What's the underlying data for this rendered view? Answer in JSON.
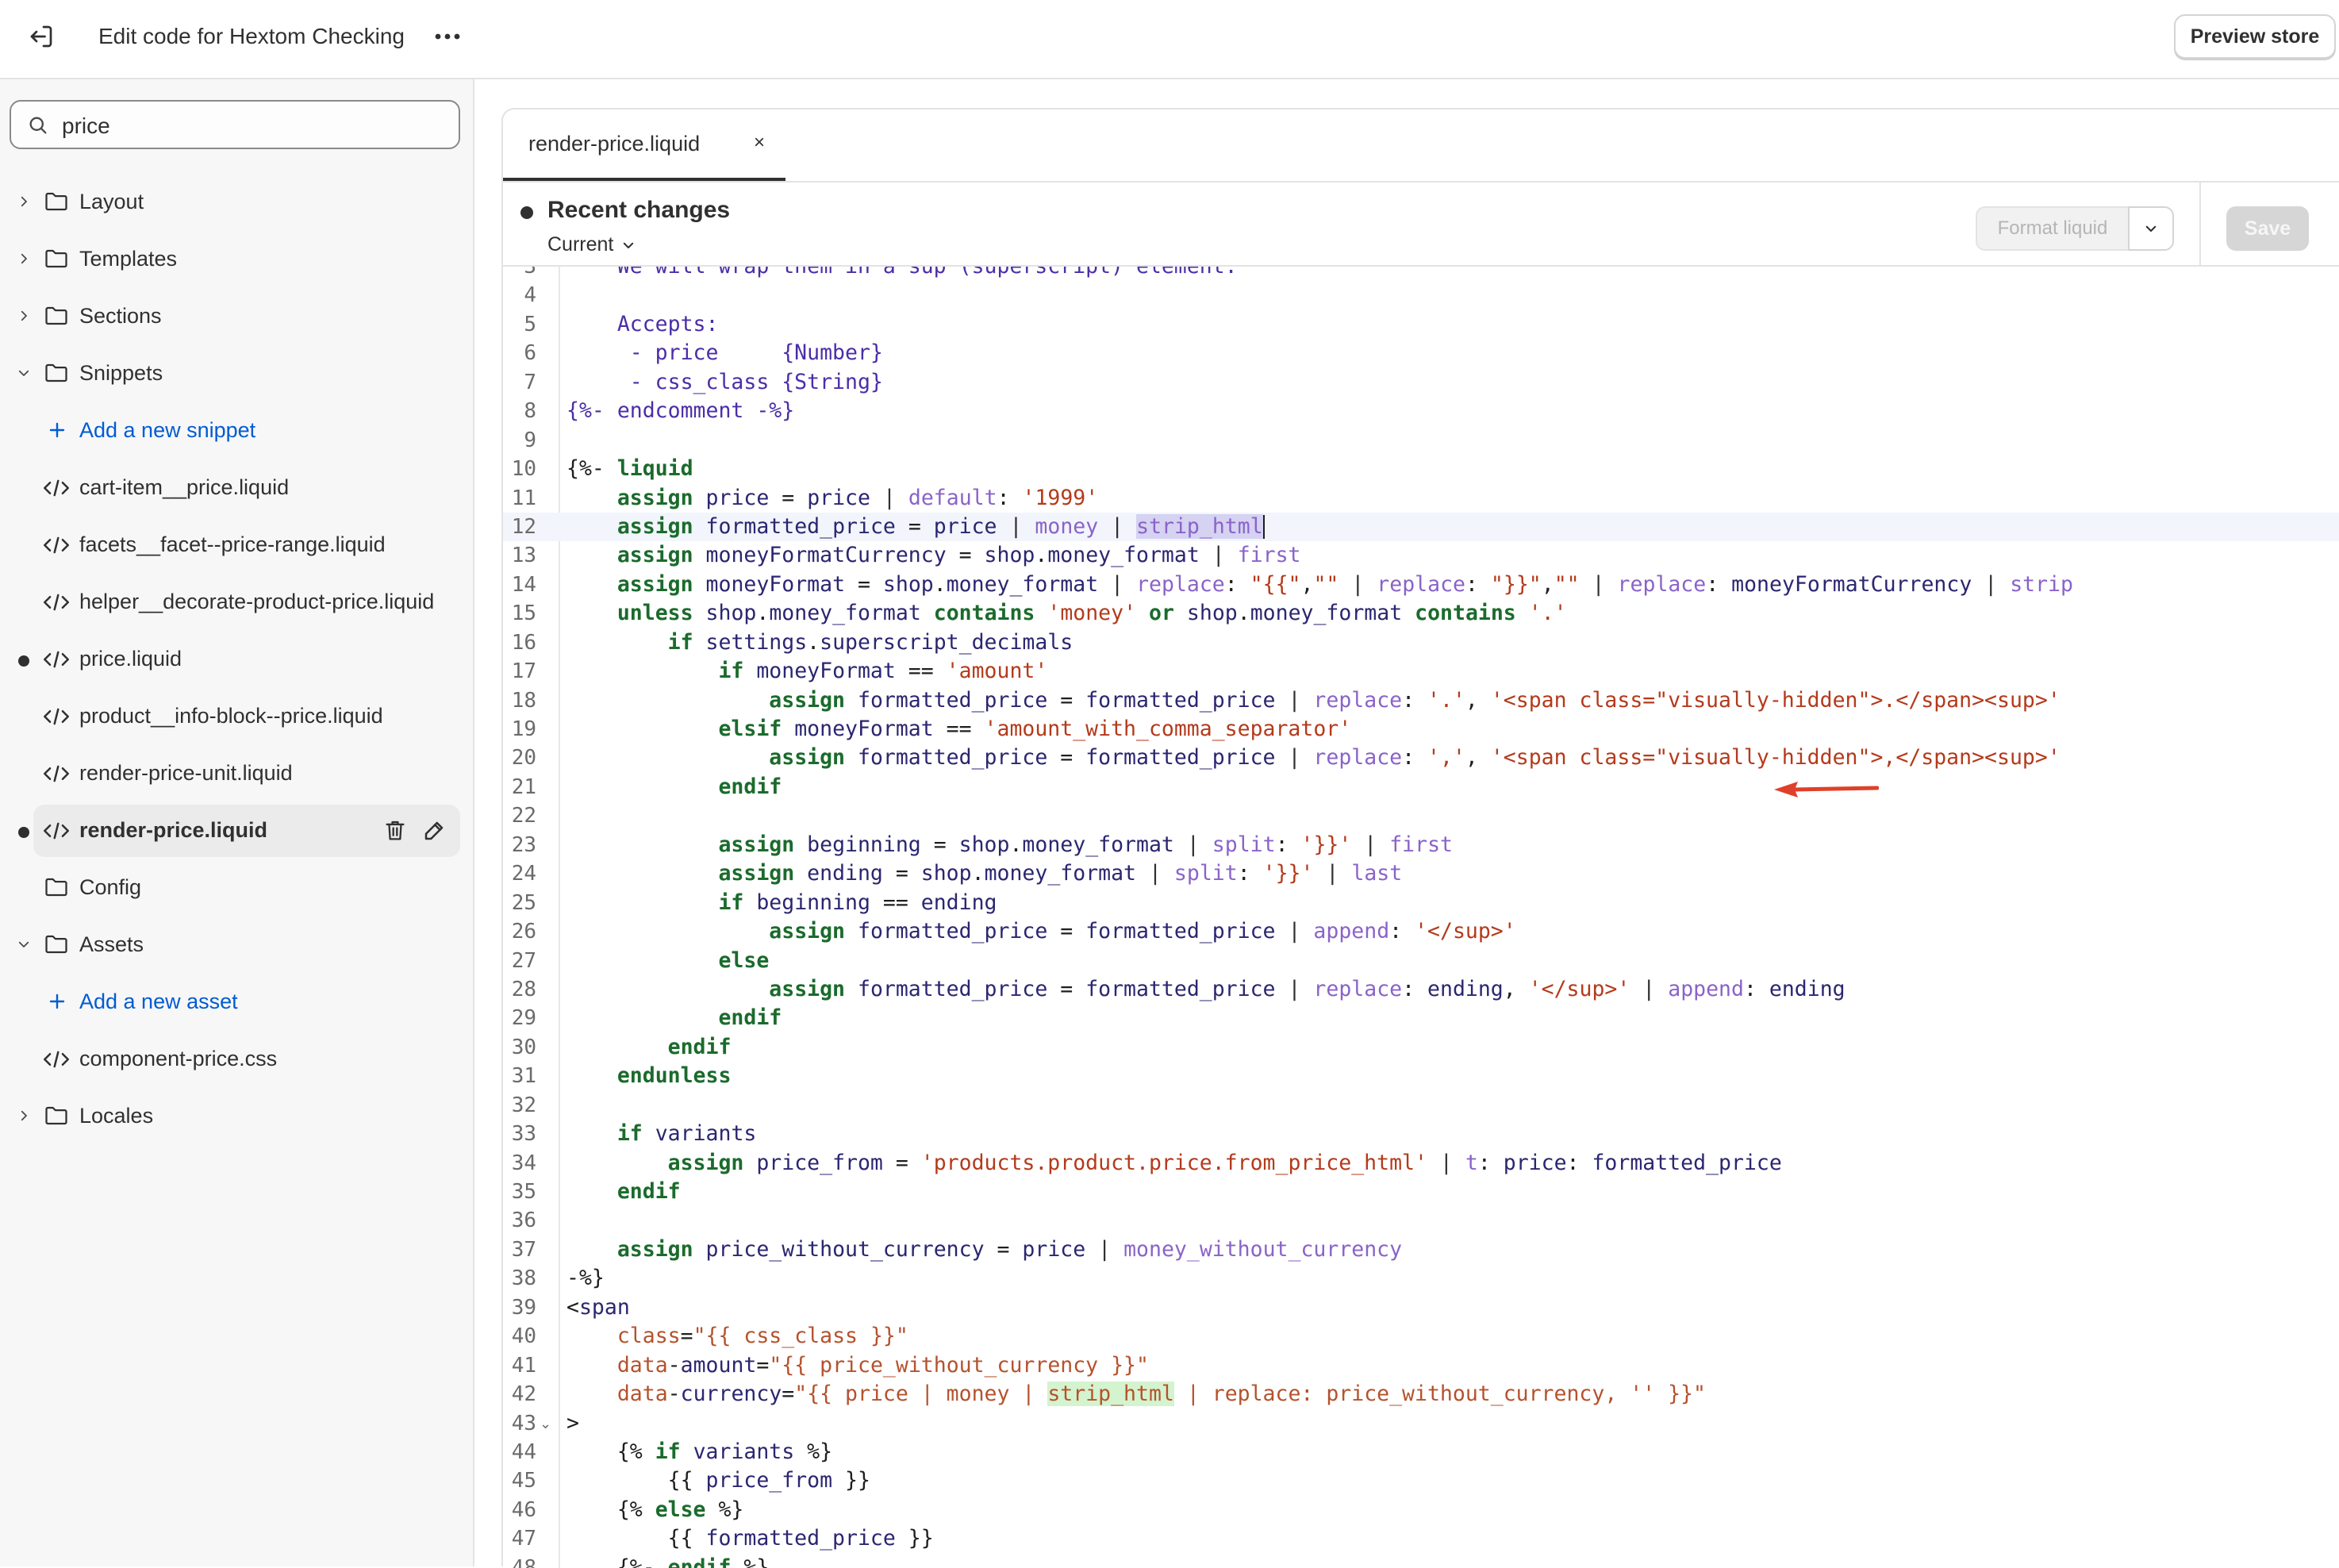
{
  "header": {
    "title": "Edit code for Hextom Checking",
    "preview_label": "Preview store"
  },
  "sidebar": {
    "search": {
      "value": "price",
      "placeholder": ""
    },
    "items": [
      {
        "type": "folder",
        "label": "Layout",
        "expanded": false
      },
      {
        "type": "folder",
        "label": "Templates",
        "expanded": false
      },
      {
        "type": "folder",
        "label": "Sections",
        "expanded": false
      },
      {
        "type": "folder",
        "label": "Snippets",
        "expanded": true
      },
      {
        "type": "add",
        "label": "Add a new snippet"
      },
      {
        "type": "file",
        "label": "cart-item__price.liquid"
      },
      {
        "type": "file",
        "label": "facets__facet--price-range.liquid"
      },
      {
        "type": "file",
        "label": "helper__decorate-product-price.liquid"
      },
      {
        "type": "file",
        "label": "price.liquid",
        "modified": true
      },
      {
        "type": "file",
        "label": "product__info-block--price.liquid"
      },
      {
        "type": "file",
        "label": "render-price-unit.liquid"
      },
      {
        "type": "file",
        "label": "render-price.liquid",
        "modified": true,
        "selected": true
      },
      {
        "type": "folder-plain",
        "label": "Config"
      },
      {
        "type": "folder",
        "label": "Assets",
        "expanded": true
      },
      {
        "type": "add",
        "label": "Add a new asset"
      },
      {
        "type": "file",
        "label": "component-price.css"
      },
      {
        "type": "folder",
        "label": "Locales",
        "expanded": false
      }
    ]
  },
  "editor": {
    "tab_label": "render-price.liquid",
    "tab_close": "×",
    "changes_title": "Recent changes",
    "version_label": "Current",
    "format_label": "Format liquid",
    "save_label": "Save",
    "active_line": 12,
    "lines": [
      {
        "n": "3",
        "text": "    We will wrap them in a sup (superscript) element."
      },
      {
        "n": "4",
        "text": ""
      },
      {
        "n": "5",
        "text": "    Accepts:"
      },
      {
        "n": "6",
        "text": "     - price     {Number}"
      },
      {
        "n": "7",
        "text": "     - css_class {String}"
      },
      {
        "n": "8",
        "text": "{%- endcomment -%}"
      },
      {
        "n": "9",
        "text": ""
      },
      {
        "n": "10",
        "text": "{%- liquid"
      },
      {
        "n": "11",
        "text": "    assign price = price | default: '1999'"
      },
      {
        "n": "12",
        "text": "    assign formatted_price = price | money | strip_html"
      },
      {
        "n": "13",
        "text": "    assign moneyFormatCurrency = shop.money_format | first"
      },
      {
        "n": "14",
        "text": "    assign moneyFormat = shop.money_format | replace: \"{{\",\"\" | replace: \"}}\",\"\" | replace: moneyFormatCurrency | strip"
      },
      {
        "n": "15",
        "text": "    unless shop.money_format contains 'money' or shop.money_format contains '.'"
      },
      {
        "n": "16",
        "text": "        if settings.superscript_decimals"
      },
      {
        "n": "17",
        "text": "            if moneyFormat == 'amount'"
      },
      {
        "n": "18",
        "text": "                assign formatted_price = formatted_price | replace: '.', '<span class=\"visually-hidden\">.</span><sup>'"
      },
      {
        "n": "19",
        "text": "            elsif moneyFormat == 'amount_with_comma_separator'"
      },
      {
        "n": "20",
        "text": "                assign formatted_price = formatted_price | replace: ',', '<span class=\"visually-hidden\">,</span><sup>'"
      },
      {
        "n": "21",
        "text": "            endif"
      },
      {
        "n": "22",
        "text": ""
      },
      {
        "n": "23",
        "text": "            assign beginning = shop.money_format | split: '}}' | first"
      },
      {
        "n": "24",
        "text": "            assign ending = shop.money_format | split: '}}' | last"
      },
      {
        "n": "25",
        "text": "            if beginning == ending"
      },
      {
        "n": "26",
        "text": "                assign formatted_price = formatted_price | append: '</sup>'"
      },
      {
        "n": "27",
        "text": "            else"
      },
      {
        "n": "28",
        "text": "                assign formatted_price = formatted_price | replace: ending, '</sup>' | append: ending"
      },
      {
        "n": "29",
        "text": "            endif"
      },
      {
        "n": "30",
        "text": "        endif"
      },
      {
        "n": "31",
        "text": "    endunless"
      },
      {
        "n": "32",
        "text": ""
      },
      {
        "n": "33",
        "text": "    if variants"
      },
      {
        "n": "34",
        "text": "        assign price_from = 'products.product.price.from_price_html' | t: price: formatted_price"
      },
      {
        "n": "35",
        "text": "    endif"
      },
      {
        "n": "36",
        "text": ""
      },
      {
        "n": "37",
        "text": "    assign price_without_currency = price | money_without_currency"
      },
      {
        "n": "38",
        "text": "-%}"
      },
      {
        "n": "39",
        "text": "<span"
      },
      {
        "n": "40",
        "text": "    class=\"{{ css_class }}\""
      },
      {
        "n": "41",
        "text": "    data-amount=\"{{ price_without_currency }}\""
      },
      {
        "n": "42",
        "text": "    data-currency=\"{{ price | money | strip_html | replace: price_without_currency, '' }}\""
      },
      {
        "n": "43",
        "text": ">"
      },
      {
        "n": "44",
        "text": "    {% if variants %}"
      },
      {
        "n": "45",
        "text": "        {{ price_from }}"
      },
      {
        "n": "46",
        "text": "    {% else %}"
      },
      {
        "n": "47",
        "text": "        {{ formatted_price }}"
      },
      {
        "n": "48",
        "text": "    {%- endif %}"
      }
    ]
  },
  "colors": {
    "accent_link": "#005bd3",
    "keyword": "#1b6b2c",
    "string": "#b43a1b",
    "filter": "#8a63c9",
    "comment": "#4b2ea8",
    "annotation_arrow": "#e0402a"
  },
  "icons": {
    "exit": "exit-icon",
    "more": "more-horizontal-icon",
    "search": "search-icon",
    "folder": "folder-icon",
    "file": "code-file-icon",
    "chevron": "chevron-icon",
    "plus": "plus-icon",
    "trash": "trash-icon",
    "edit": "pencil-icon"
  }
}
